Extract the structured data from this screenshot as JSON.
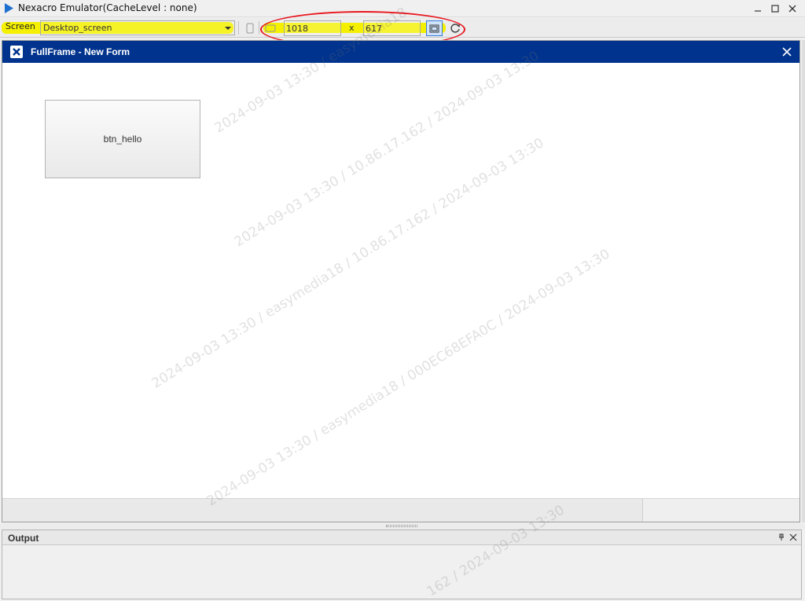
{
  "window": {
    "title": "Nexacro Emulator(CacheLevel : none)",
    "controls": [
      "minimize-icon",
      "maximize-icon",
      "close-icon"
    ]
  },
  "toolbar": {
    "screen_label": "Screen",
    "screen_value": "Desktop_screen",
    "width_value": "1018",
    "x_label": "x",
    "height_value": "617"
  },
  "form": {
    "title": "FullFrame - New Form",
    "button_label": "btn_hello"
  },
  "output": {
    "title": "Output"
  },
  "watermark": {
    "lines": [
      "2024-09-03 13:30 / easymedia18",
      "2024-09-03 13:30 / 10.86.17.162 / 2024-09-03 13:30",
      "2024-09-03 13:30 / easymedia18 / 10.86.17.162 / 2024-09-03 13:30",
      "2024-09-03 13:30 / easymedia18 / 000EC68EFA0C / 2024-09-03 13:30",
      "162 / 2024-09-03 13:30"
    ]
  },
  "colors": {
    "form_header": "#00338d",
    "highlight": "#f4f000",
    "annotation": "#e8151d"
  }
}
